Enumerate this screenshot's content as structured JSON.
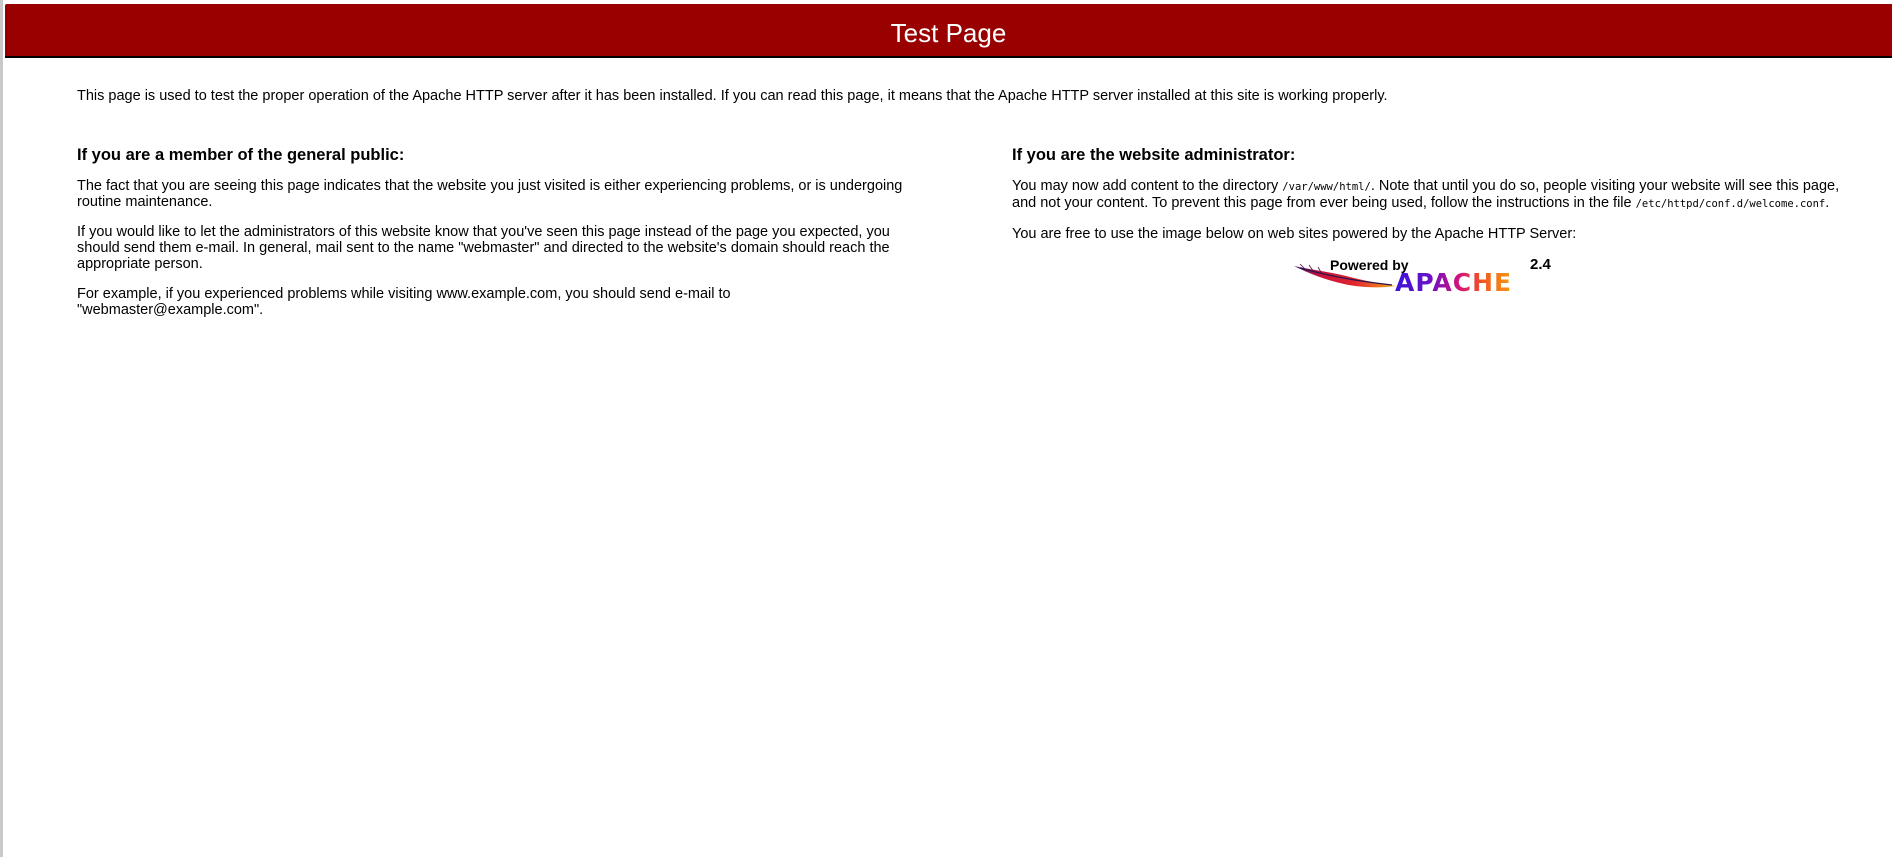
{
  "header": {
    "title": "Test Page",
    "background_color": "#990000"
  },
  "intro": "This page is used to test the proper operation of the Apache HTTP server after it has been installed. If you can read this page, it means that the Apache HTTP server installed at this site is working properly.",
  "public_section": {
    "heading": "If you are a member of the general public:",
    "paragraph_1": "The fact that you are seeing this page indicates that the website you just visited is either experiencing problems, or is undergoing routine maintenance.",
    "paragraph_2": "If you would like to let the administrators of this website know that you've seen this page instead of the page you expected, you should send them e-mail. In general, mail sent to the name \"webmaster\" and directed to the website's domain should reach the appropriate person.",
    "paragraph_3": "For example, if you experienced problems while visiting www.example.com, you should send e-mail to \"webmaster@example.com\"."
  },
  "admin_section": {
    "heading": "If you are the website administrator:",
    "paragraph_1_before": "You may now add content to the directory ",
    "paragraph_1_path": "/var/www/html/",
    "paragraph_1_middle": ". Note that until you do so, people visiting your website will see this page, and not your content. To prevent this page from ever being used, follow the instructions in the file ",
    "paragraph_1_file": "/etc/httpd/conf.d/welcome.conf",
    "paragraph_1_after": ".",
    "paragraph_2": "You are free to use the image below on web sites powered by the Apache HTTP Server:"
  },
  "logo": {
    "powered_by": "Powered by",
    "version": "2.4",
    "brand": "APACHE",
    "icon": "apache-feather-icon"
  }
}
